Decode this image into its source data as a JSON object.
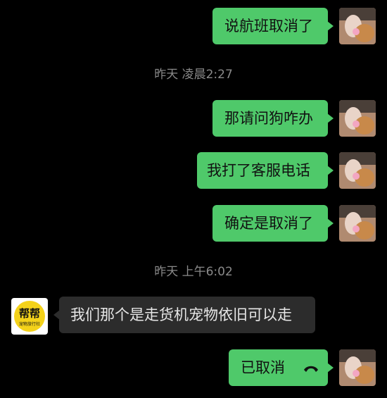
{
  "messages": [
    {
      "text": "说航班取消了"
    },
    {
      "text": "那请问狗咋办"
    },
    {
      "text": "我打了客服电话"
    },
    {
      "text": "确定是取消了"
    },
    {
      "text": "我们那个是走货机宠物依旧可以走"
    },
    {
      "text": "已取消",
      "icon": "phone-hangup-icon"
    }
  ],
  "timestamps": [
    "昨天 凌晨2:27",
    "昨天 上午6:02"
  ],
  "shop_avatar": {
    "main": "帮帮",
    "sub": "宠物旅行社"
  },
  "colors": {
    "background": "#000000",
    "outgoing_bubble": "#4fc96a",
    "incoming_bubble": "#2c2c2c",
    "timestamp": "#8a8a8a",
    "shop_logo": "#f4d21a"
  }
}
